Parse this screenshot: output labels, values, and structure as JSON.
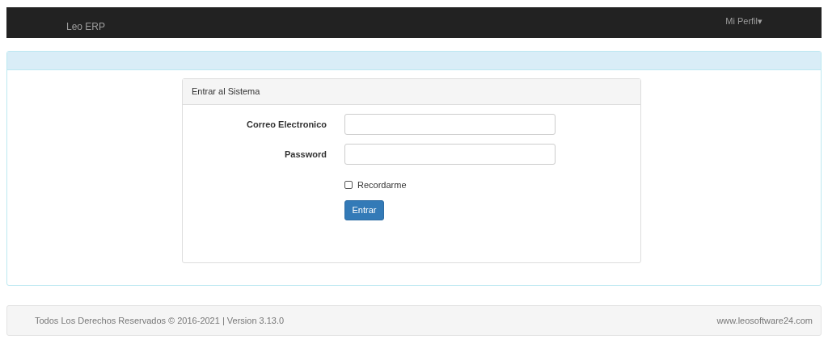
{
  "navbar": {
    "brand": "Leo ERP",
    "menu": {
      "label": "Mi Perfil",
      "caret": "▾"
    }
  },
  "login": {
    "title": "Entrar al Sistema",
    "fields": [
      {
        "label": "Correo Electronico"
      },
      {
        "label": "Password"
      }
    ],
    "remember": {
      "label": "Recordarme",
      "checked": false
    },
    "submit": "Entrar"
  },
  "footer": {
    "copyright": "Todos Los Derechos Reservados © 2016-2021 | Version 3.13.0",
    "website": "www.leosoftware24.com"
  }
}
